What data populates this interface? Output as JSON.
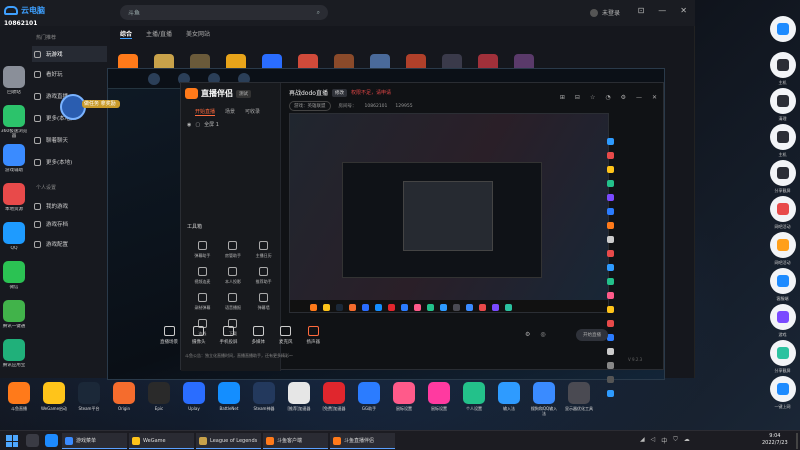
{
  "app": {
    "logo_text": "云电脑",
    "machine_id": "10862101",
    "search_placeholder": "斗鱼",
    "login_text": "未登录",
    "window_controls": [
      "⊡",
      "—",
      "✕"
    ],
    "tabs": [
      "综合",
      "主播/直播",
      "美女网站"
    ]
  },
  "left_apps": [
    {
      "label": "回收站",
      "color": "#8a8f99"
    },
    {
      "label": "360极速浏览器",
      "color": "#2cc36b"
    },
    {
      "label": "游戏辅助",
      "color": "#3a8bff"
    },
    {
      "label": "本地资源",
      "color": "#e84a4a"
    },
    {
      "label": "QQ",
      "color": "#1e9bff"
    },
    {
      "label": "微信",
      "color": "#2bc253"
    },
    {
      "label": "腾讯一键通",
      "color": "#41b34a"
    },
    {
      "label": "腾讯应用宝",
      "color": "#20b07a"
    }
  ],
  "nav": {
    "section1": "热门推荐",
    "items1": [
      "玩游戏",
      "看好玩",
      "游戏直播",
      "更多(本地)",
      "聊着聊天",
      "更多(本地)"
    ],
    "section2": "个人设置",
    "items2": [
      "我的游戏",
      "游戏存档",
      "游戏配置"
    ]
  },
  "promo": {
    "text": "做任务 拿奖励"
  },
  "douyu": {
    "brand": "直播伴侣",
    "beta": "测试",
    "tabs": [
      "开始直播",
      "场景",
      "可收录"
    ],
    "scene": "全屏 1",
    "room_title": "再战dodo直播",
    "edit": "修改",
    "warning": "权限不足，请申请",
    "category_label": "游戏：英雄联盟",
    "room_label": "房间号：",
    "room_id": "10862101",
    "fans_count": "129955",
    "tools_title": "工具箱",
    "tools": [
      "弹幕助手",
      "房管助手",
      "主播日历",
      "视频连麦",
      "本人投影",
      "推荐助手",
      "录制弹幕",
      "语音播报",
      "弹幕墙",
      "连线",
      "下载"
    ],
    "notice": "斗鱼公告：独立化直播时间，直播直播助手，还有更多精彩～",
    "controls": [
      "直播场景",
      "摄像头",
      "手机投屏",
      "多媒体",
      "麦克风",
      "扬声器"
    ],
    "live_button": "开始直播",
    "version": "V 9.2.3"
  },
  "right_dock": [
    {
      "label": "",
      "color": "#1d8bff"
    },
    {
      "label": "主机",
      "color": "#2b2e36"
    },
    {
      "label": "清理",
      "color": "#2b2e36"
    },
    {
      "label": "主机",
      "color": "#2b2e36"
    },
    {
      "label": "分享截屏",
      "color": "#2b2e36"
    },
    {
      "label": "网吧活动",
      "color": "#e84a4a"
    },
    {
      "label": "网吧活动",
      "color": "#ff9f1a"
    },
    {
      "label": "客服端",
      "color": "#1d8bff"
    },
    {
      "label": "游戏",
      "color": "#7a4aff"
    },
    {
      "label": "分享截屏",
      "color": "#2bc2a0"
    },
    {
      "label": "一键上网",
      "color": "#1d8bff"
    }
  ],
  "shelf": [
    {
      "label": "斗鱼直播",
      "color": "#ff7a1a"
    },
    {
      "label": "WeGame启动",
      "color": "#ffc41a"
    },
    {
      "label": "Steam平台",
      "color": "#1b2838"
    },
    {
      "label": "Origin",
      "color": "#f56c2d"
    },
    {
      "label": "Epic",
      "color": "#2a2a2a"
    },
    {
      "label": "Uplay",
      "color": "#2a6dff"
    },
    {
      "label": "BattleNet",
      "color": "#148eff"
    },
    {
      "label": "Steam神器",
      "color": "#23395d"
    },
    {
      "label": "[推荐]加速器",
      "color": "#e6e6e6"
    },
    {
      "label": "[免费]加速器",
      "color": "#e0262d"
    },
    {
      "label": "GG助手",
      "color": "#2b7cff"
    },
    {
      "label": "鼠标设置",
      "color": "#ff5a8a"
    },
    {
      "label": "鼠标设置",
      "color": "#ff3aa0"
    },
    {
      "label": "个人设置",
      "color": "#23c18a"
    },
    {
      "label": "输入法",
      "color": "#2e9bff"
    },
    {
      "label": "搜狗和QQ输入法",
      "color": "#3a8bff"
    },
    {
      "label": "显示器优化工具",
      "color": "#4a4a52"
    }
  ],
  "taskbar": {
    "apps": [
      {
        "label": "游戏菜单",
        "color": "#3a8bff"
      },
      {
        "label": "WeGame",
        "color": "#ffc41a"
      },
      {
        "label": "League of Legends",
        "color": "#c8a24a"
      },
      {
        "label": "斗鱼客户端",
        "color": "#ff7a1a"
      },
      {
        "label": "斗鱼直播伴侣",
        "color": "#ff7a1a"
      }
    ],
    "time": "9:04",
    "date": "2022/7/23"
  }
}
